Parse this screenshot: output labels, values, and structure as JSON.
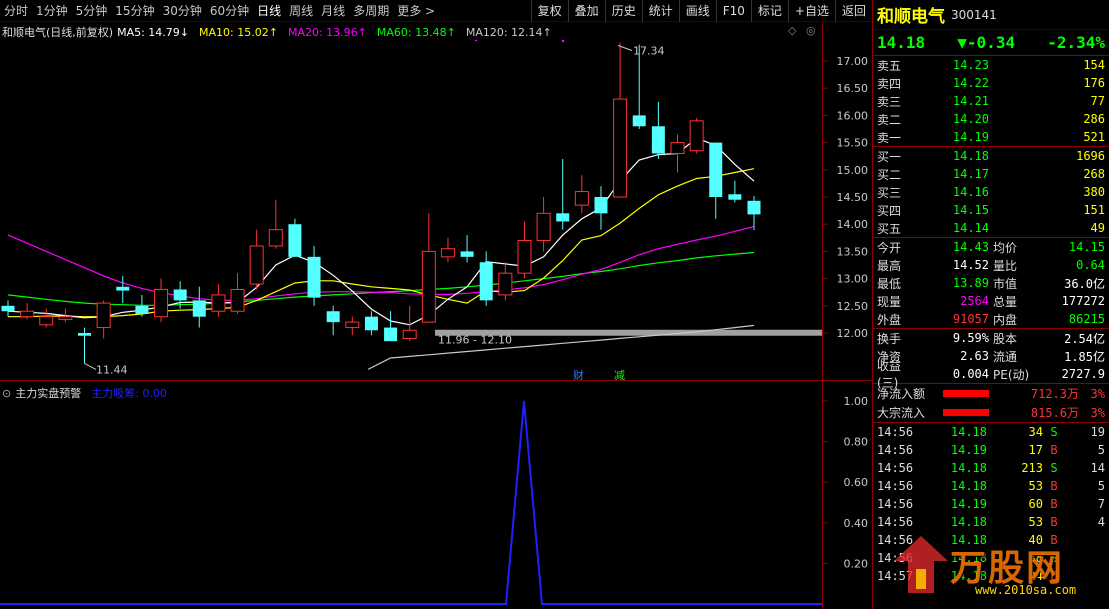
{
  "toolbar": {
    "periods": [
      "分时",
      "1分钟",
      "5分钟",
      "15分钟",
      "30分钟",
      "60分钟",
      "日线",
      "周线",
      "月线",
      "多周期",
      "更多 >"
    ],
    "active_period": "日线",
    "actions": [
      "复权",
      "叠加",
      "历史",
      "统计",
      "画线",
      "F10",
      "标记",
      "+自选",
      "返回"
    ]
  },
  "legend": {
    "title": "和顺电气(日线,前复权)",
    "items": [
      {
        "label": "MA5: 14.79↓",
        "color": "#ffffff"
      },
      {
        "label": "MA10: 15.02↑",
        "color": "#ffff00"
      },
      {
        "label": "MA20: 13.96↑",
        "color": "#ff00ff"
      },
      {
        "label": "MA60: 13.48↑",
        "color": "#00ff00"
      },
      {
        "label": "MA120: 12.14↑",
        "color": "#c8c8c8"
      }
    ]
  },
  "sub_legend": {
    "title": "主力实盘预警",
    "item": "主力吸筹: 0.00",
    "item_color": "#2020ff"
  },
  "annotations": {
    "high": "17.34",
    "low": "11.44",
    "range": "11.96 - 12.10",
    "cai": "财",
    "jian": "减"
  },
  "chart_data": [
    {
      "type": "candlestick",
      "title": "和顺电气(日线,前复权)",
      "y_ticks": [
        "17.00",
        "16.50",
        "16.00",
        "15.50",
        "15.00",
        "14.50",
        "14.00",
        "13.50",
        "13.00",
        "12.50",
        "12.00"
      ],
      "ylim": [
        11.2,
        17.5
      ],
      "candles": [
        {
          "o": 12.5,
          "c": 12.4,
          "h": 12.6,
          "l": 12.3
        },
        {
          "o": 12.3,
          "c": 12.4,
          "h": 12.55,
          "l": 12.25
        },
        {
          "o": 12.15,
          "c": 12.3,
          "h": 12.45,
          "l": 12.1
        },
        {
          "o": 12.25,
          "c": 12.3,
          "h": 12.45,
          "l": 12.2
        },
        {
          "o": 12.0,
          "c": 11.95,
          "h": 12.1,
          "l": 11.44
        },
        {
          "o": 12.1,
          "c": 12.55,
          "h": 12.6,
          "l": 11.9
        },
        {
          "o": 12.85,
          "c": 12.78,
          "h": 13.05,
          "l": 12.55
        },
        {
          "o": 12.5,
          "c": 12.35,
          "h": 12.7,
          "l": 12.3
        },
        {
          "o": 12.3,
          "c": 12.8,
          "h": 13.0,
          "l": 12.2
        },
        {
          "o": 12.8,
          "c": 12.6,
          "h": 12.95,
          "l": 12.45
        },
        {
          "o": 12.6,
          "c": 12.3,
          "h": 12.85,
          "l": 12.1
        },
        {
          "o": 12.4,
          "c": 12.7,
          "h": 12.9,
          "l": 12.3
        },
        {
          "o": 12.4,
          "c": 12.8,
          "h": 13.1,
          "l": 12.35
        },
        {
          "o": 12.9,
          "c": 13.6,
          "h": 13.9,
          "l": 12.8
        },
        {
          "o": 13.6,
          "c": 13.9,
          "h": 14.45,
          "l": 13.55
        },
        {
          "o": 14.0,
          "c": 13.4,
          "h": 14.1,
          "l": 13.4
        },
        {
          "o": 13.4,
          "c": 12.65,
          "h": 13.6,
          "l": 12.5
        },
        {
          "o": 12.4,
          "c": 12.2,
          "h": 12.5,
          "l": 11.96
        },
        {
          "o": 12.1,
          "c": 12.2,
          "h": 12.3,
          "l": 11.96
        },
        {
          "o": 12.3,
          "c": 12.05,
          "h": 12.4,
          "l": 11.96
        },
        {
          "o": 12.1,
          "c": 11.85,
          "h": 12.4,
          "l": 11.85
        },
        {
          "o": 11.9,
          "c": 12.05,
          "h": 12.5,
          "l": 11.85
        },
        {
          "o": 12.2,
          "c": 13.5,
          "h": 14.2,
          "l": 12.2
        },
        {
          "o": 13.4,
          "c": 13.55,
          "h": 13.75,
          "l": 13.3
        },
        {
          "o": 13.5,
          "c": 13.4,
          "h": 13.8,
          "l": 13.3
        },
        {
          "o": 13.3,
          "c": 12.6,
          "h": 13.5,
          "l": 12.5
        },
        {
          "o": 12.7,
          "c": 13.1,
          "h": 13.3,
          "l": 12.6
        },
        {
          "o": 13.1,
          "c": 13.7,
          "h": 14.05,
          "l": 13.0
        },
        {
          "o": 13.7,
          "c": 14.2,
          "h": 14.5,
          "l": 13.5
        },
        {
          "o": 14.2,
          "c": 14.05,
          "h": 15.2,
          "l": 13.9
        },
        {
          "o": 14.35,
          "c": 14.6,
          "h": 14.9,
          "l": 14.2
        },
        {
          "o": 14.5,
          "c": 14.2,
          "h": 14.7,
          "l": 13.9
        },
        {
          "o": 14.5,
          "c": 16.3,
          "h": 17.34,
          "l": 14.5
        },
        {
          "o": 16.0,
          "c": 15.8,
          "h": 17.3,
          "l": 15.75
        },
        {
          "o": 15.8,
          "c": 15.3,
          "h": 16.25,
          "l": 15.2
        },
        {
          "o": 15.3,
          "c": 15.5,
          "h": 15.65,
          "l": 14.95
        },
        {
          "o": 15.35,
          "c": 15.9,
          "h": 15.95,
          "l": 15.3
        },
        {
          "o": 15.5,
          "c": 14.5,
          "h": 15.5,
          "l": 14.1
        },
        {
          "o": 14.55,
          "c": 14.45,
          "h": 14.8,
          "l": 14.4
        },
        {
          "o": 14.43,
          "c": 14.18,
          "h": 14.52,
          "l": 13.89
        }
      ],
      "ma5": [
        12.4,
        12.38,
        12.36,
        12.32,
        12.28,
        12.3,
        12.38,
        12.42,
        12.48,
        12.56,
        12.57,
        12.55,
        12.56,
        12.84,
        13.25,
        13.43,
        13.3,
        13.06,
        12.77,
        12.44,
        12.22,
        12.15,
        12.33,
        12.62,
        12.85,
        13.31,
        13.27,
        13.23,
        13.4,
        13.8,
        14.1,
        14.3,
        14.8,
        15.18,
        15.28,
        15.3,
        15.58,
        15.45,
        15.1,
        14.79
      ],
      "ma10": [
        12.3,
        12.3,
        12.31,
        12.31,
        12.3,
        12.3,
        12.32,
        12.35,
        12.4,
        12.42,
        12.43,
        12.45,
        12.47,
        12.6,
        12.76,
        12.92,
        12.96,
        12.96,
        12.9,
        12.85,
        12.82,
        12.79,
        12.7,
        12.62,
        12.55,
        12.78,
        12.75,
        12.78,
        13.01,
        13.33,
        13.71,
        13.79,
        14.02,
        14.29,
        14.54,
        14.7,
        14.84,
        14.88,
        14.95,
        15.02
      ],
      "ma20": [
        13.8,
        13.65,
        13.5,
        13.35,
        13.2,
        13.05,
        12.92,
        12.82,
        12.74,
        12.68,
        12.63,
        12.6,
        12.6,
        12.63,
        12.68,
        12.72,
        12.75,
        12.76,
        12.76,
        12.75,
        12.74,
        12.72,
        12.71,
        12.71,
        12.73,
        12.76,
        12.79,
        12.83,
        12.89,
        12.98,
        13.08,
        13.17,
        13.3,
        13.44,
        13.55,
        13.63,
        13.71,
        13.78,
        13.87,
        13.96
      ],
      "ma60": [
        12.7,
        12.66,
        12.62,
        12.58,
        12.55,
        12.53,
        12.52,
        12.51,
        12.51,
        12.52,
        12.53,
        12.55,
        12.57,
        12.6,
        12.63,
        12.66,
        12.68,
        12.7,
        12.72,
        12.74,
        12.76,
        12.78,
        12.8,
        12.82,
        12.85,
        12.88,
        12.92,
        12.96,
        13.0,
        13.04,
        13.09,
        13.13,
        13.18,
        13.24,
        13.29,
        13.33,
        13.38,
        13.42,
        13.45,
        13.48
      ],
      "ma120": [
        null,
        null,
        null,
        null,
        null,
        null,
        null,
        null,
        null,
        null,
        null,
        null,
        null,
        null,
        null,
        null,
        null,
        null,
        null,
        null,
        11.54,
        11.57,
        11.6,
        11.63,
        11.66,
        11.69,
        11.72,
        11.75,
        11.78,
        11.81,
        11.84,
        11.87,
        11.9,
        11.93,
        11.96,
        11.99,
        12.02,
        12.06,
        12.1,
        12.14
      ]
    },
    {
      "type": "line",
      "title": "主力实盘预警",
      "series": [
        {
          "name": "主力吸筹",
          "values": [
            0,
            0,
            0,
            0,
            0,
            0,
            0,
            0,
            0,
            0,
            0,
            0,
            0,
            0,
            0,
            0,
            0,
            0,
            0,
            0,
            0,
            0,
            0,
            0,
            0,
            1,
            0,
            0,
            0,
            0,
            0,
            0,
            0,
            0,
            0,
            0,
            0,
            0,
            0,
            0
          ]
        }
      ],
      "y_ticks": [
        "1.00",
        "0.80",
        "0.60",
        "0.40",
        "0.20"
      ],
      "ylim": [
        0,
        1.05
      ]
    }
  ],
  "quote": {
    "name": "和顺电气",
    "code": "300141",
    "price": "14.18",
    "change": "▼-0.34",
    "change_pct": "-2.34%",
    "sell": [
      {
        "label": "卖五",
        "price": "14.23",
        "vol": "154"
      },
      {
        "label": "卖四",
        "price": "14.22",
        "vol": "176"
      },
      {
        "label": "卖三",
        "price": "14.21",
        "vol": "77"
      },
      {
        "label": "卖二",
        "price": "14.20",
        "vol": "286"
      },
      {
        "label": "卖一",
        "price": "14.19",
        "vol": "521"
      }
    ],
    "buy": [
      {
        "label": "买一",
        "price": "14.18",
        "vol": "1696"
      },
      {
        "label": "买二",
        "price": "14.17",
        "vol": "268"
      },
      {
        "label": "买三",
        "price": "14.16",
        "vol": "380"
      },
      {
        "label": "买四",
        "price": "14.15",
        "vol": "151"
      },
      {
        "label": "买五",
        "price": "14.14",
        "vol": "49"
      }
    ],
    "stats1": [
      {
        "l1": "今开",
        "v1": "14.43",
        "c1": "#00ff00",
        "l2": "均价",
        "v2": "14.15",
        "c2": "#00ff00"
      },
      {
        "l1": "最高",
        "v1": "14.52",
        "c1": "#ffffff",
        "l2": "量比",
        "v2": "0.64",
        "c2": "#00ff00"
      },
      {
        "l1": "最低",
        "v1": "13.89",
        "c1": "#00ff00",
        "l2": "市值",
        "v2": "36.0亿",
        "c2": "#ffffff"
      },
      {
        "l1": "现量",
        "v1": "2564",
        "c1": "#ff00ff",
        "l2": "总量",
        "v2": "177272",
        "c2": "#ffffff"
      },
      {
        "l1": "外盘",
        "v1": "91057",
        "c1": "#ff3333",
        "l2": "内盘",
        "v2": "86215",
        "c2": "#00ff00"
      }
    ],
    "stats2": [
      {
        "l1": "换手",
        "v1": "9.59%",
        "c1": "#ffffff",
        "l2": "股本",
        "v2": "2.54亿",
        "c2": "#ffffff"
      },
      {
        "l1": "净资",
        "v1": "2.63",
        "c1": "#ffffff",
        "l2": "流通",
        "v2": "1.85亿",
        "c2": "#ffffff"
      },
      {
        "l1": "收益(三)",
        "v1": "0.004",
        "c1": "#ffffff",
        "l2": "PE(动)",
        "v2": "2727.9",
        "c2": "#ffffff"
      }
    ],
    "flows": [
      {
        "label": "净流入额",
        "value": "712.3万",
        "pct": "3%"
      },
      {
        "label": "大宗流入",
        "value": "815.6万",
        "pct": "3%"
      }
    ],
    "ticks": [
      {
        "time": "14:56",
        "price": "14.18",
        "vol": "34",
        "side": "S",
        "n": "19"
      },
      {
        "time": "14:56",
        "price": "14.19",
        "vol": "17",
        "side": "B",
        "n": "5"
      },
      {
        "time": "14:56",
        "price": "14.18",
        "vol": "213",
        "side": "S",
        "n": "14"
      },
      {
        "time": "14:56",
        "price": "14.18",
        "vol": "53",
        "side": "B",
        "n": "5"
      },
      {
        "time": "14:56",
        "price": "14.19",
        "vol": "60",
        "side": "B",
        "n": "7"
      },
      {
        "time": "14:56",
        "price": "14.18",
        "vol": "53",
        "side": "B",
        "n": "4"
      },
      {
        "time": "14:56",
        "price": "14.18",
        "vol": "40",
        "side": "B",
        "n": ""
      },
      {
        "time": "14:56",
        "price": "14.18",
        "vol": "38",
        "side": "S",
        "n": ""
      },
      {
        "time": "14:57",
        "price": "14.18",
        "vol": "24",
        "side": "B",
        "n": ""
      }
    ]
  },
  "watermark": {
    "text": "万股网",
    "url": "www.2010sa.com"
  }
}
